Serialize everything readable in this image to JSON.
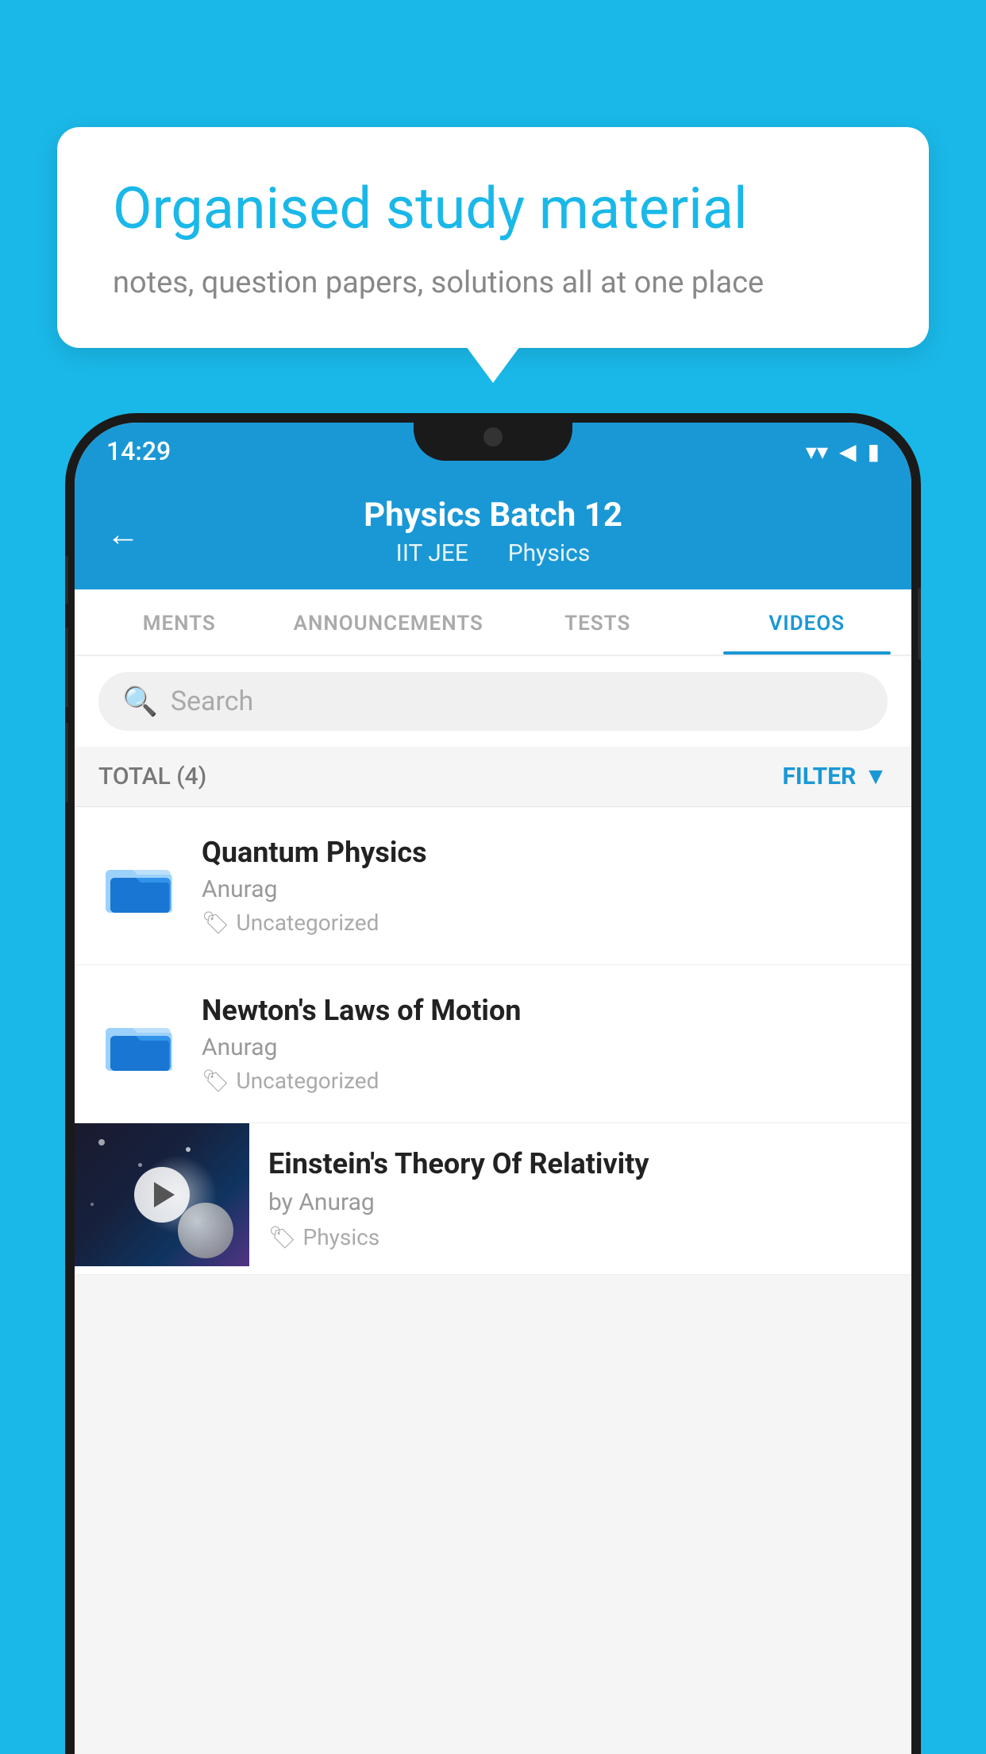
{
  "bubble": {
    "title": "Organised study material",
    "subtitle": "notes, question papers, solutions all at one place"
  },
  "status_bar": {
    "time": "14:29",
    "wifi": "▾",
    "signal": "▲",
    "battery": "▮"
  },
  "header": {
    "back_label": "←",
    "title": "Physics Batch 12",
    "subtitle_1": "IIT JEE",
    "subtitle_2": "Physics"
  },
  "tabs": [
    {
      "label": "MENTS",
      "active": false
    },
    {
      "label": "ANNOUNCEMENTS",
      "active": false
    },
    {
      "label": "TESTS",
      "active": false
    },
    {
      "label": "VIDEOS",
      "active": true
    }
  ],
  "search": {
    "placeholder": "Search"
  },
  "filter_bar": {
    "total_label": "TOTAL (4)",
    "filter_label": "FILTER"
  },
  "videos": [
    {
      "title": "Quantum Physics",
      "author": "Anurag",
      "tag": "Uncategorized",
      "has_thumb": false
    },
    {
      "title": "Newton's Laws of Motion",
      "author": "Anurag",
      "tag": "Uncategorized",
      "has_thumb": false
    },
    {
      "title": "Einstein's Theory Of Relativity",
      "author": "by Anurag",
      "tag": "Physics",
      "has_thumb": true
    }
  ]
}
